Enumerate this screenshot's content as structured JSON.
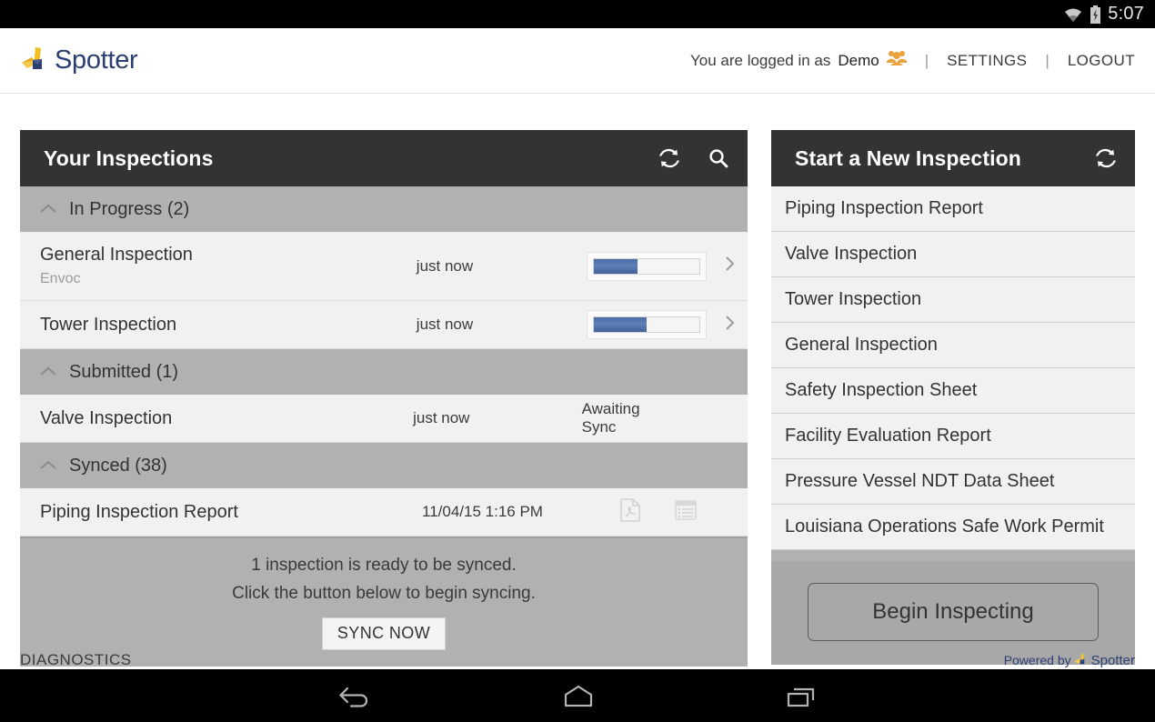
{
  "status_bar": {
    "time": "5:07",
    "icons": [
      "wifi-icon",
      "battery-charging-icon"
    ]
  },
  "header": {
    "brand": "Spotter",
    "logged_in_prefix": "You are logged in as",
    "user": "Demo",
    "user_icon": "users-group-icon",
    "separator": "|",
    "settings": "SETTINGS",
    "logout": "LOGOUT"
  },
  "left_panel": {
    "title": "Your Inspections",
    "refresh_icon": "refresh-icon",
    "search_icon": "search-icon",
    "sections": [
      {
        "label": "In Progress (2)",
        "rows": [
          {
            "title": "General Inspection",
            "subtitle": "Envoc",
            "time": "just now",
            "progress": 41,
            "chevron": "chevron-right-icon"
          },
          {
            "title": "Tower Inspection",
            "subtitle": "",
            "time": "just now",
            "progress": 50,
            "chevron": "chevron-right-icon"
          }
        ]
      },
      {
        "label": "Submitted (1)",
        "rows": [
          {
            "title": "Valve Inspection",
            "subtitle": "",
            "time": "just now",
            "status": "Awaiting Sync"
          }
        ]
      },
      {
        "label": "Synced (38)",
        "rows": [
          {
            "title": "Piping Inspection Report",
            "subtitle": "",
            "time": "11/04/15 1:16 PM",
            "actions": [
              "pdf-icon",
              "list-view-icon"
            ]
          }
        ]
      }
    ],
    "sync_footer": {
      "line1": "1 inspection is ready to be synced.",
      "line2": "Click the button below to begin syncing.",
      "button": "SYNC NOW"
    }
  },
  "right_panel": {
    "title": "Start a New Inspection",
    "refresh_icon": "refresh-icon",
    "templates": [
      "Piping Inspection Report",
      "Valve Inspection",
      "Tower Inspection",
      "General Inspection",
      "Safety Inspection Sheet",
      "Facility Evaluation Report",
      "Pressure Vessel NDT Data Sheet",
      "Louisiana Operations Safe Work Permit"
    ],
    "begin_button": "Begin Inspecting"
  },
  "footer": {
    "diagnostics": "DIAGNOSTICS",
    "powered_by": "Powered by",
    "powered_brand": "Spotter"
  },
  "nav_bar": {
    "back": "back-icon",
    "home": "home-icon",
    "recents": "recent-apps-icon"
  },
  "colors": {
    "panel_header_bg": "#333333",
    "section_header_bg": "#b1b1b1",
    "row_bg": "#f1f1f1",
    "brand_blue": "#2b3f73",
    "brand_gold": "#f0ab2a",
    "progress_blue": "#4a6ea9",
    "users_icon_orange": "#e8a33d"
  }
}
